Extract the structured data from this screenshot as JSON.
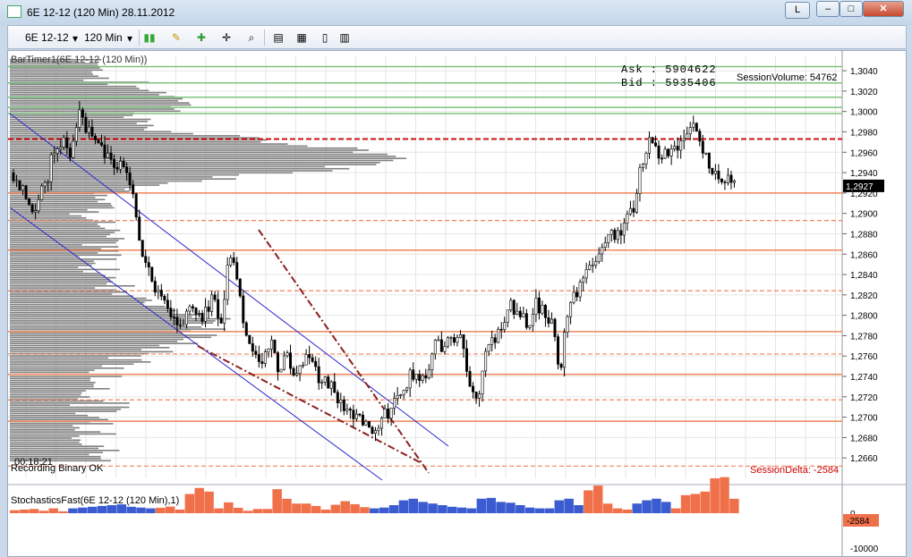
{
  "window": {
    "title": "6E 12-12 (120 Min)  28.11.2012",
    "l_label": "L",
    "min_label": "–",
    "max_label": "□",
    "close_label": "✕"
  },
  "toolbar": {
    "instrument": "6E 12-12",
    "interval": "120 Min",
    "icons": [
      "bar-style-icon",
      "pen-icon",
      "crosshair-icon",
      "zoom-icon",
      "data-box-icon",
      "chart-properties-icon",
      "strategy-icon",
      "panels-icon"
    ]
  },
  "price_panel": {
    "title": "BarTimer1(6E 12-12 (120 Min))",
    "ask": "Ask : 5904622",
    "bid": "Bid : 5935406",
    "session_volume": "SessionVolume: 54762",
    "bar_timer": "00:18:21",
    "recording": "Recording Binary OK",
    "session_delta": "SessionDelta: -2584",
    "current_price": "1,2927"
  },
  "stoch_panel": {
    "title": "StochasticsFast(6E 12-12 (120 Min),1)",
    "zero_label": "0",
    "current": "-2584",
    "bottom_label": "-10000"
  },
  "colors": {
    "bg": "#ffffff",
    "grid": "#e6e6e6",
    "orange": "#f0845a",
    "green": "#7cc47f",
    "red": "#cc1111",
    "blue": "#2828cc",
    "dotted": "#8b2020",
    "volume": "#808080",
    "pos": "#3a5cd0",
    "neg": "#f0704a"
  },
  "chart_data": {
    "type": "candlestick",
    "ylim": [
      1.264,
      1.3055
    ],
    "y_ticks": [
      "1,3040",
      "1,3020",
      "1,3000",
      "1,2980",
      "1,2960",
      "1,2940",
      "1,2920",
      "1,2900",
      "1,2880",
      "1,2860",
      "1,2840",
      "1,2820",
      "1,2800",
      "1,2780",
      "1,2760",
      "1,2740",
      "1,2720",
      "1,2700",
      "1,2680",
      "1,2660"
    ],
    "orange_solid": [
      1.292,
      1.2864,
      1.2784,
      1.2742,
      1.2696
    ],
    "orange_dashed": [
      1.2893,
      1.2824,
      1.2762,
      1.2717,
      1.2652
    ],
    "green_lines": [
      1.3044,
      1.3028,
      1.3014,
      1.3004,
      1.2998
    ],
    "red_dashed": 1.2973,
    "close_path": [
      1.294,
      1.2925,
      1.2905,
      1.2912,
      1.293,
      1.2968,
      1.297,
      1.296,
      1.2995,
      1.298,
      1.2975,
      1.296,
      1.295,
      1.2945,
      1.2935,
      1.2885,
      1.2845,
      1.283,
      1.281,
      1.28,
      1.279,
      1.2802,
      1.2806,
      1.28,
      1.282,
      1.279,
      1.286,
      1.284,
      1.2785,
      1.276,
      1.2755,
      1.2772,
      1.2745,
      1.2765,
      1.2733,
      1.2755,
      1.2758,
      1.273,
      1.2735,
      1.2717,
      1.2712,
      1.27,
      1.2697,
      1.2685,
      1.268,
      1.2705,
      1.2712,
      1.2725,
      1.2745,
      1.274,
      1.2748,
      1.277,
      1.2772,
      1.278,
      1.2775,
      1.274,
      1.272,
      1.276,
      1.2775,
      1.279,
      1.281,
      1.2805,
      1.279,
      1.2815,
      1.28,
      1.279,
      1.2745,
      1.281,
      1.282,
      1.285,
      1.2855,
      1.287,
      1.288,
      1.288,
      1.29,
      1.291,
      1.2955,
      1.2975,
      1.2958,
      1.2955,
      1.2965,
      1.2975,
      1.299,
      1.297,
      1.295,
      1.294,
      1.2935,
      1.2927
    ],
    "volume_profile_note": "horizontal gray volume profile on left side",
    "stoch_values": [
      -250,
      -300,
      -350,
      -200,
      -400,
      -150,
      300,
      350,
      400,
      450,
      500,
      550,
      400,
      350,
      300,
      -450,
      -550,
      -300,
      -1600,
      -2100,
      -1800,
      -400,
      -900,
      -450,
      -200,
      -350,
      -350,
      -2000,
      -1200,
      -800,
      -800,
      -600,
      -300,
      -700,
      -1000,
      -750,
      -500,
      300,
      350,
      500,
      800,
      900,
      700,
      600,
      500,
      400,
      350,
      300,
      900,
      950,
      700,
      650,
      500,
      350,
      300,
      300,
      800,
      900,
      500,
      -1900,
      -2300,
      -800,
      -400,
      -300,
      600,
      800,
      900,
      700,
      -400,
      -1500,
      -1600,
      -1800,
      -2900,
      -3000,
      -1200
    ],
    "stoch_ylim": [
      -3200,
      1500
    ]
  }
}
